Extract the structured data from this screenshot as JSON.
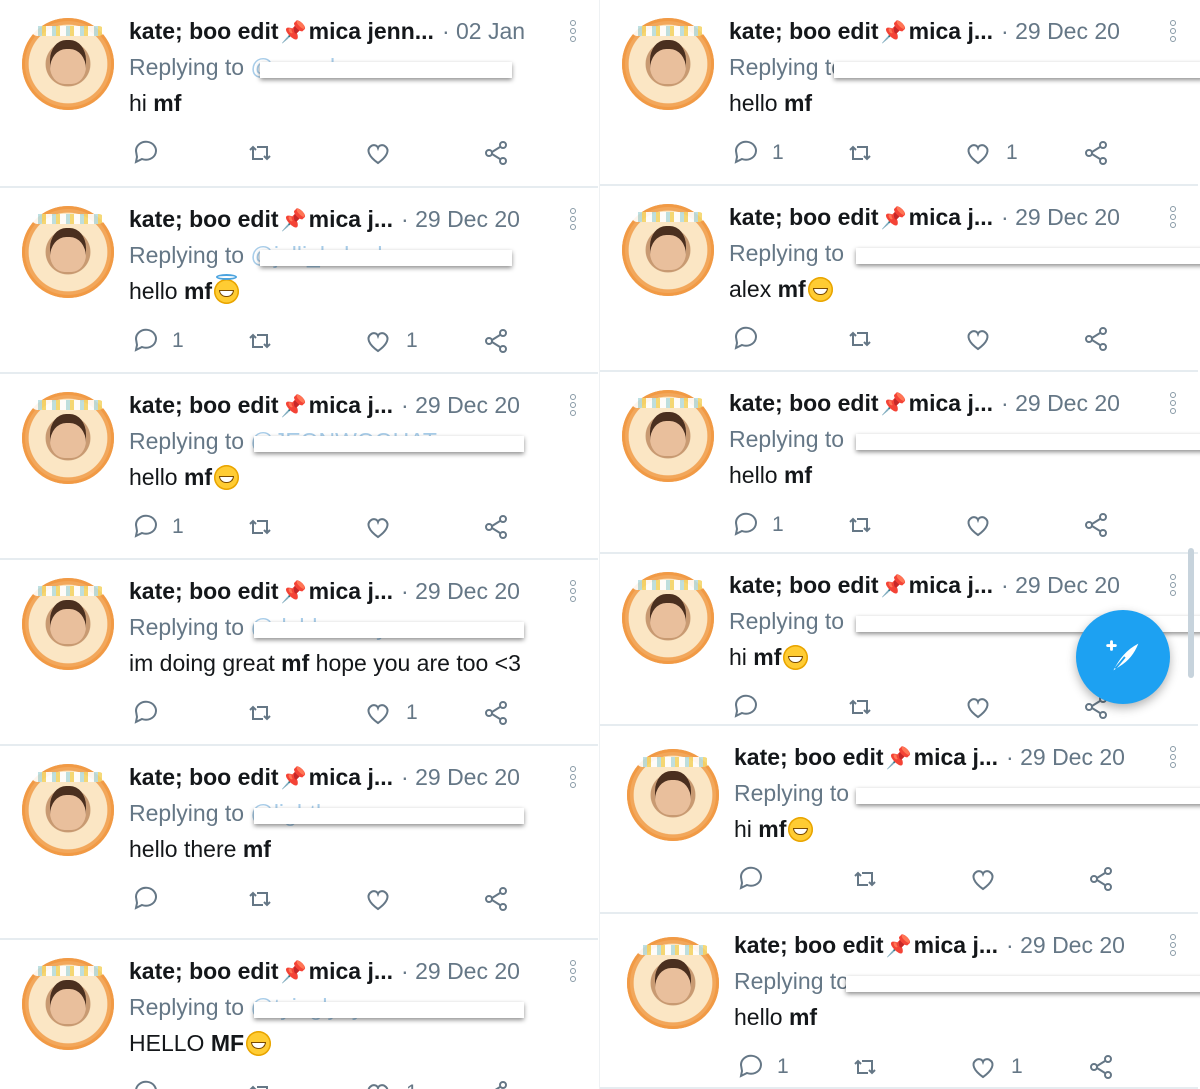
{
  "profile": {
    "name": "kate; boo edit",
    "pin": "📌"
  },
  "tweets": {
    "0": {
      "name": "kate; boo edit",
      "name2": "mica jenn...",
      "date": "· 02 Jan",
      "replying": "Replying to",
      "handle": "@samelaveme",
      "text_pre": "hi ",
      "text_bold": "mf",
      "text_post": "",
      "reply_count": "",
      "like_count": ""
    },
    "1": {
      "name": "kate; boo edit",
      "name2": "mica j...",
      "date": "· 29 Dec 20",
      "replying": "Replying to",
      "handle": "@jelli_kehral",
      "text_pre": "hello ",
      "text_bold": "mf",
      "text_post": "",
      "reply_count": "1",
      "like_count": "1"
    },
    "2": {
      "name": "kate; boo edit",
      "name2": "mica j...",
      "date": "· 29 Dec 20",
      "replying": "Replying to",
      "handle": "@JEONWOOHAT",
      "text_pre": "hello ",
      "text_bold": "mf",
      "text_post": "",
      "reply_count": "1",
      "like_count": ""
    },
    "3": {
      "name": "kate; boo edit",
      "name2": "mica j...",
      "date": "· 29 Dec 20",
      "replying": "Replying to",
      "handle": "@dabhenoey",
      "text_pre": "im doing great ",
      "text_bold": "mf",
      "text_post": " hope you are too <3",
      "reply_count": "",
      "like_count": "1"
    },
    "4": {
      "name": "kate; boo edit",
      "name2": "mica j...",
      "date": "· 29 Dec 20",
      "replying": "Replying to",
      "handle": "@lightboss",
      "text_pre": "hello there ",
      "text_bold": "mf",
      "text_post": "",
      "reply_count": "",
      "like_count": ""
    },
    "5": {
      "name": "kate; boo edit",
      "name2": "mica j...",
      "date": "· 29 Dec 20",
      "replying": "Replying to",
      "handle": "@tyinglyny",
      "text_pre": "HELLO ",
      "text_bold": "MF",
      "text_post": "",
      "reply_count": "",
      "like_count": "1"
    },
    "6": {
      "name": "kate; boo edit",
      "name2": "mica j...",
      "date": "· 29 Dec 20",
      "replying": "Replying to",
      "handle": "",
      "text_pre": "hello ",
      "text_bold": "mf",
      "text_post": "",
      "reply_count": "1",
      "like_count": "1"
    },
    "7": {
      "name": "kate; boo edit",
      "name2": "mica j...",
      "date": "· 29 Dec 20",
      "replying": "Replying to",
      "handle": "",
      "text_pre": "alex ",
      "text_bold": "mf",
      "text_post": "",
      "reply_count": "",
      "like_count": ""
    },
    "8": {
      "name": "kate; boo edit",
      "name2": "mica j...",
      "date": "· 29 Dec 20",
      "replying": "Replying to",
      "handle": "",
      "text_pre": "hello ",
      "text_bold": "mf",
      "text_post": "",
      "reply_count": "1",
      "like_count": ""
    },
    "9": {
      "name": "kate; boo edit",
      "name2": "mica j...",
      "date": "· 29 Dec 20",
      "replying": "Replying to",
      "handle": "",
      "text_pre": "hi ",
      "text_bold": "mf",
      "text_post": "",
      "reply_count": "",
      "like_count": ""
    },
    "10": {
      "name": "kate; boo edit",
      "name2": "mica j...",
      "date": "· 29 Dec 20",
      "replying": "Replying to",
      "handle": "",
      "text_pre": "hi ",
      "text_bold": "mf",
      "text_post": "",
      "reply_count": "",
      "like_count": ""
    },
    "11": {
      "name": "kate; boo edit",
      "name2": "mica j...",
      "date": "· 29 Dec 20",
      "replying": "Replying to",
      "handle": "",
      "text_pre": "hello ",
      "text_bold": "mf",
      "text_post": "",
      "reply_count": "1",
      "like_count": "1"
    }
  },
  "icons": {
    "reply": "reply-icon",
    "retweet": "retweet-icon",
    "like": "heart-icon",
    "share": "share-icon",
    "more": "more-icon",
    "compose": "compose-tweet-icon"
  },
  "colors": {
    "accent": "#1da1f2",
    "muted": "#657786",
    "text": "#14171a",
    "divider": "#e6ecf0"
  }
}
